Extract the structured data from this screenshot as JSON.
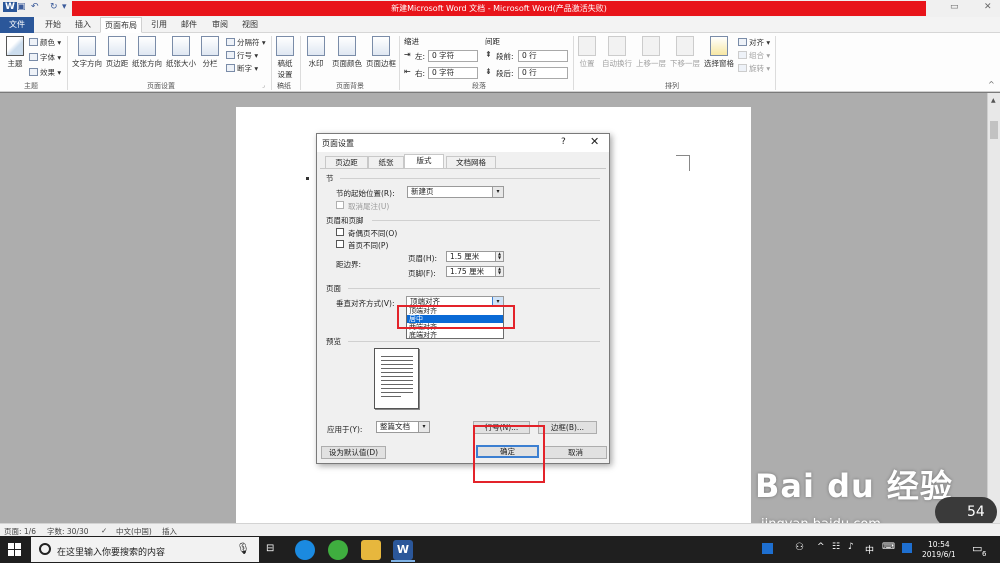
{
  "titlebar": {
    "title": "新建Microsoft Word 文档 - Microsoft Word(产品激活失败)",
    "app_icon": "W"
  },
  "ribbon_tabs": [
    "文件",
    "开始",
    "插入",
    "页面布局",
    "引用",
    "邮件",
    "审阅",
    "视图"
  ],
  "ribbon": {
    "theme": {
      "big": "主题",
      "colors": "颜色",
      "fonts": "字体",
      "effects": "效果",
      "group": "主题"
    },
    "page_setup": {
      "text_direction": "文字方向",
      "margins": "页边距",
      "orientation": "纸张方向",
      "size": "纸张大小",
      "columns": "分栏",
      "breaks": "分隔符",
      "line_numbers": "行号",
      "hyphenation": "断字",
      "group": "页面设置"
    },
    "manuscript": {
      "label_line1": "稿纸",
      "label_line2": "设置",
      "group": "稿纸"
    },
    "page_background": {
      "watermark": "水印",
      "page_color": "页面颜色",
      "page_borders": "页面边框",
      "group": "页面背景"
    },
    "paragraph": {
      "indent_title": "缩进",
      "spacing_title": "间距",
      "left_label": "左:",
      "left_value": "0 字符",
      "right_label": "右:",
      "right_value": "0 字符",
      "before_label": "段前:",
      "before_value": "0 行",
      "after_label": "段后:",
      "after_value": "0 行",
      "group": "段落"
    },
    "arrange": {
      "position": "位置",
      "wrap": "自动换行",
      "forward": "上移一层",
      "backward": "下移一层",
      "pane": "选择窗格",
      "align": "对齐",
      "group_btn": "组合",
      "rotate": "旋转",
      "group": "排列"
    }
  },
  "dialog": {
    "title": "页面设置",
    "help": "?",
    "tabs": [
      "页边距",
      "纸张",
      "版式",
      "文档网格"
    ],
    "section_title": "节",
    "section_start_label": "节的起始位置(R):",
    "section_start_value": "新建页",
    "suppress_endnotes": "取消尾注(U)",
    "headers_title": "页眉和页脚",
    "odd_even": "奇偶页不同(O)",
    "first_page": "首页不同(P)",
    "from_edge": "距边界:",
    "header_label": "页眉(H):",
    "header_value": "1.5 厘米",
    "footer_label": "页脚(F):",
    "footer_value": "1.75 厘米",
    "page_title": "页面",
    "valign_label": "垂直对齐方式(V):",
    "valign_value": "顶端对齐",
    "valign_options": [
      "顶端对齐",
      "居中",
      "两端对齐",
      "底端对齐"
    ],
    "preview_title": "预览",
    "apply_label": "应用于(Y):",
    "apply_value": "整篇文档",
    "line_numbers_btn": "行号(N)...",
    "borders_btn": "边框(B)...",
    "default_btn": "设为默认值(D)",
    "ok_btn": "确定",
    "cancel_btn": "取消"
  },
  "statusbar": {
    "page": "页面: 1/6",
    "words": "字数: 30/30",
    "language": "中文(中国)",
    "mode": "插入"
  },
  "taskbar": {
    "search_placeholder": "在这里输入你要搜索的内容",
    "time": "10:54",
    "date": "2019/6/1",
    "ime": "中",
    "notifications": "6"
  },
  "watermark": {
    "brand": "Bai du 经验",
    "url": "jingyan.baidu.com"
  },
  "speed": "54",
  "colors": {
    "title_red": "#e8141a",
    "file_tab": "#2b579a",
    "highlight": "#0a6ad6",
    "callout_red": "#e3232a"
  }
}
